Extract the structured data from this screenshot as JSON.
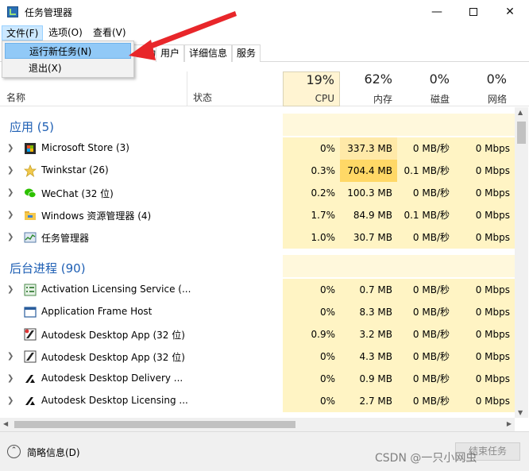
{
  "window": {
    "title": "任务管理器",
    "minimize": "—",
    "close": "✕"
  },
  "menu": {
    "file": "文件(F)",
    "options": "选项(O)",
    "view": "查看(V)"
  },
  "file_menu": {
    "run_new_task": "运行新任务(N)",
    "exit": "退出(X)"
  },
  "tabs": {
    "startup_partial": "启动",
    "users": "用户",
    "details": "详细信息",
    "services": "服务"
  },
  "columns": {
    "name": "名称",
    "status": "状态",
    "cpu": {
      "pct": "19%",
      "label": "CPU"
    },
    "memory": {
      "pct": "62%",
      "label": "内存"
    },
    "disk": {
      "pct": "0%",
      "label": "磁盘"
    },
    "network": {
      "pct": "0%",
      "label": "网络"
    }
  },
  "groups": {
    "apps": "应用 (5)",
    "background": "后台进程 (90)"
  },
  "apps": [
    {
      "name": "Microsoft Store (3)",
      "cpu": "0%",
      "memory": "337.3 MB",
      "disk": "0 MB/秒",
      "network": "0 Mbps",
      "icon": "store-icon"
    },
    {
      "name": "Twinkstar (26)",
      "cpu": "0.3%",
      "memory": "704.4 MB",
      "disk": "0.1 MB/秒",
      "network": "0 Mbps",
      "icon": "star-icon"
    },
    {
      "name": "WeChat (32 位)",
      "cpu": "0.2%",
      "memory": "100.3 MB",
      "disk": "0 MB/秒",
      "network": "0 Mbps",
      "icon": "wechat-icon"
    },
    {
      "name": "Windows 资源管理器 (4)",
      "cpu": "1.7%",
      "memory": "84.9 MB",
      "disk": "0.1 MB/秒",
      "network": "0 Mbps",
      "icon": "folder-icon"
    },
    {
      "name": "任务管理器",
      "cpu": "1.0%",
      "memory": "30.7 MB",
      "disk": "0 MB/秒",
      "network": "0 Mbps",
      "icon": "task-manager-icon"
    }
  ],
  "background": [
    {
      "name": "Activation Licensing Service (...",
      "cpu": "0%",
      "memory": "0.7 MB",
      "disk": "0 MB/秒",
      "network": "0 Mbps",
      "icon": "service-icon"
    },
    {
      "name": "Application Frame Host",
      "cpu": "0%",
      "memory": "8.3 MB",
      "disk": "0 MB/秒",
      "network": "0 Mbps",
      "icon": "window-icon"
    },
    {
      "name": "Autodesk Desktop App (32 位)",
      "cpu": "0.9%",
      "memory": "3.2 MB",
      "disk": "0 MB/秒",
      "network": "0 Mbps",
      "icon": "autodesk-icon"
    },
    {
      "name": "Autodesk Desktop App (32 位)",
      "cpu": "0%",
      "memory": "4.3 MB",
      "disk": "0 MB/秒",
      "network": "0 Mbps",
      "icon": "autodesk-icon"
    },
    {
      "name": "Autodesk Desktop Delivery ...",
      "cpu": "0%",
      "memory": "0.9 MB",
      "disk": "0 MB/秒",
      "network": "0 Mbps",
      "icon": "autodesk-a-icon"
    },
    {
      "name": "Autodesk Desktop Licensing ...",
      "cpu": "0%",
      "memory": "2.7 MB",
      "disk": "0 MB/秒",
      "network": "0 Mbps",
      "icon": "autodesk-a-icon"
    }
  ],
  "footer": {
    "fewer_details": "简略信息(D)",
    "end_task": "结束任务",
    "watermark": "CSDN @一只小网虫"
  }
}
